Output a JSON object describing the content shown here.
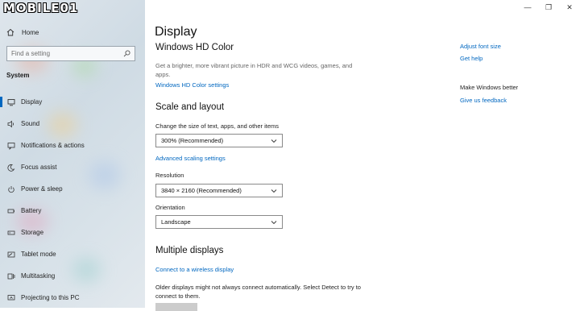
{
  "logo": {
    "text": "MOBILE01"
  },
  "sidebar": {
    "home_label": "Home",
    "search_placeholder": "Find a setting",
    "section_title": "System",
    "items": [
      {
        "label": "Display",
        "icon": "monitor-icon",
        "active": true
      },
      {
        "label": "Sound",
        "icon": "speaker-icon"
      },
      {
        "label": "Notifications & actions",
        "icon": "message-icon"
      },
      {
        "label": "Focus assist",
        "icon": "moon-icon"
      },
      {
        "label": "Power & sleep",
        "icon": "power-icon"
      },
      {
        "label": "Battery",
        "icon": "battery-icon"
      },
      {
        "label": "Storage",
        "icon": "storage-icon"
      },
      {
        "label": "Tablet mode",
        "icon": "tablet-icon"
      },
      {
        "label": "Multitasking",
        "icon": "multitasking-icon"
      },
      {
        "label": "Projecting to this PC",
        "icon": "project-icon"
      }
    ]
  },
  "window_controls": {
    "minimize": "—",
    "maximize": "❐",
    "close": "✕"
  },
  "main": {
    "title": "Display",
    "hd_color": {
      "heading": "Windows HD Color",
      "description": "Get a brighter, more vibrant picture in HDR and WCG videos, games, and apps.",
      "link": "Windows HD Color settings"
    },
    "scale": {
      "heading": "Scale and layout",
      "size_label": "Change the size of text, apps, and other items",
      "size_value": "300% (Recommended)",
      "advanced_link": "Advanced scaling settings",
      "resolution_label": "Resolution",
      "resolution_value": "3840 × 2160 (Recommended)",
      "orientation_label": "Orientation",
      "orientation_value": "Landscape"
    },
    "multiple": {
      "heading": "Multiple displays",
      "wireless_link": "Connect to a wireless display",
      "description": "Older displays might not always connect automatically. Select Detect to try to connect to them."
    }
  },
  "right_panel": {
    "adjust_font_link": "Adjust font size",
    "help_link": "Get help",
    "better_heading": "Make Windows better",
    "feedback_link": "Give us feedback"
  },
  "colors": {
    "accent": "#0067c0"
  }
}
